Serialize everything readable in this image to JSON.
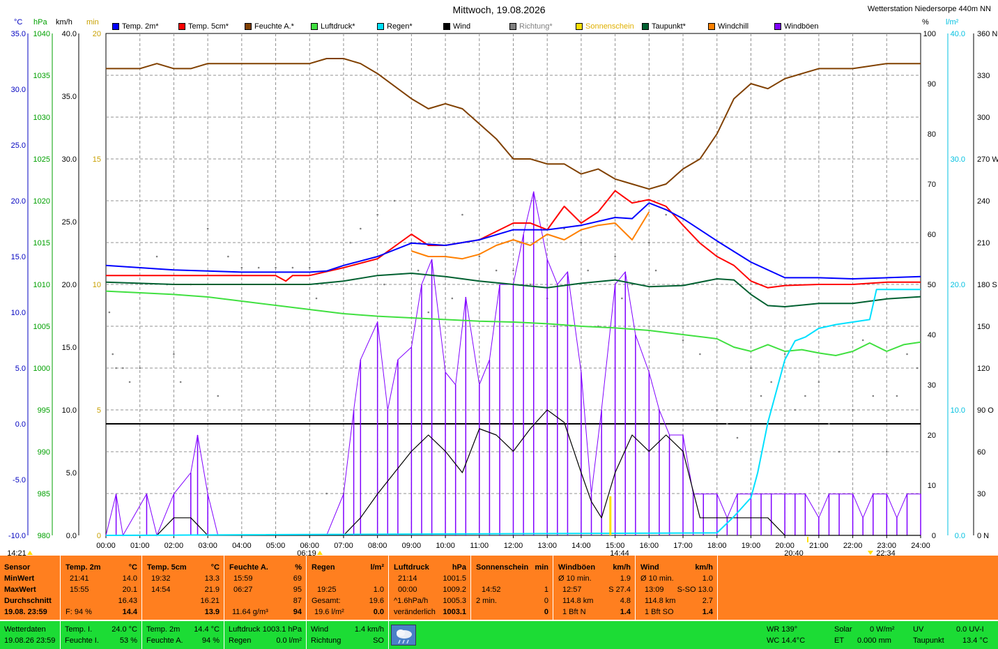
{
  "header": {
    "title": "Mittwoch, 19.08.2026",
    "station": "Wetterstation Niedersorpe 440m NN",
    "units_left": [
      "°C",
      "hPa",
      "km/h",
      "min"
    ],
    "units_right": [
      "%",
      "l/m²"
    ]
  },
  "legend": [
    {
      "label": "Temp. 2m*",
      "color": "#0000ff"
    },
    {
      "label": "Temp. 5cm*",
      "color": "#ff0000"
    },
    {
      "label": "Feuchte A.*",
      "color": "#804000"
    },
    {
      "label": "Luftdruck*",
      "color": "#40e040"
    },
    {
      "label": "Regen*",
      "color": "#00e0ff"
    },
    {
      "label": "Wind",
      "color": "#000000"
    },
    {
      "label": "Richtung*",
      "color": "#808080"
    },
    {
      "label": "Sonnenschein",
      "color": "#ffe000"
    },
    {
      "label": "Taupunkt*",
      "color": "#006030"
    },
    {
      "label": "Windchill",
      "color": "#ff8000"
    },
    {
      "label": "Windböen",
      "color": "#8000ff"
    }
  ],
  "chart_data": {
    "type": "line",
    "x_ticks": [
      "00:00",
      "01:00",
      "02:00",
      "03:00",
      "04:00",
      "05:00",
      "06:00",
      "07:00",
      "08:00",
      "09:00",
      "10:00",
      "11:00",
      "12:00",
      "13:00",
      "14:00",
      "15:00",
      "16:00",
      "17:00",
      "18:00",
      "19:00",
      "20:00",
      "21:00",
      "22:00",
      "23:00",
      "24:00"
    ],
    "axes": {
      "temp_c": {
        "ticks": [
          "35.0",
          "30.0",
          "25.0",
          "20.0",
          "15.0",
          "10.0",
          "5.0",
          "0.0",
          "-5.0",
          "-10.0"
        ],
        "range": [
          -10,
          35
        ],
        "color": "#0000c0"
      },
      "pressure_hpa": {
        "ticks": [
          "1040",
          "1035",
          "1030",
          "1025",
          "1020",
          "1015",
          "1010",
          "1005",
          "1000",
          "995",
          "990",
          "985",
          "980"
        ],
        "range": [
          980,
          1040
        ],
        "color": "#00a000"
      },
      "wind_kmh": {
        "ticks": [
          "40.0",
          "35.0",
          "30.0",
          "25.0",
          "20.0",
          "15.0",
          "10.0",
          "5.0",
          "0.0"
        ],
        "range": [
          0,
          40
        ],
        "color": "#000000"
      },
      "sun_min": {
        "ticks": [
          "20",
          "15",
          "10",
          "5",
          "0"
        ],
        "range": [
          0,
          20
        ],
        "color": "#c8a000"
      },
      "humidity_pct": {
        "ticks": [
          "100",
          "90",
          "80",
          "70",
          "60",
          "50",
          "40",
          "30",
          "20",
          "10",
          "0"
        ],
        "range": [
          0,
          100
        ],
        "color": "#000000"
      },
      "rain_lm2": {
        "ticks": [
          "40.0",
          "30.0",
          "20.0",
          "10.0",
          "0.0"
        ],
        "range": [
          0,
          40
        ],
        "color": "#00c0e0"
      },
      "direction": {
        "ticks": [
          "360 N",
          "330",
          "300",
          "270 W",
          "240",
          "210",
          "180 S",
          "150",
          "120",
          "90 O",
          "60",
          "30",
          "0 N"
        ],
        "range": [
          0,
          360
        ],
        "color": "#000000"
      }
    },
    "series": [
      {
        "name": "Temp. 2m*",
        "color": "#0000ff",
        "axis": "temp_c",
        "x": [
          0,
          1,
          2,
          3,
          4,
          5,
          6,
          6.5,
          7,
          8,
          9,
          10,
          11,
          12,
          13,
          14,
          15,
          15.5,
          16,
          16.5,
          17,
          18,
          19,
          20,
          21,
          22,
          23,
          24
        ],
        "y": [
          14.2,
          14.0,
          13.8,
          13.7,
          13.6,
          13.6,
          13.6,
          13.7,
          14.2,
          15.0,
          16.2,
          16.0,
          16.5,
          17.4,
          17.4,
          17.8,
          18.5,
          18.4,
          19.8,
          19.2,
          18.4,
          16.4,
          14.5,
          13.1,
          13.1,
          13.0,
          13.1,
          13.2
        ]
      },
      {
        "name": "Temp. 5cm*",
        "color": "#ff0000",
        "axis": "temp_c",
        "x": [
          0,
          1,
          2,
          3,
          4,
          5,
          5.3,
          5.5,
          6,
          7,
          8,
          9,
          9.5,
          10,
          11,
          12,
          12.5,
          13,
          13.5,
          14,
          14.5,
          15,
          15.5,
          16,
          16.5,
          17,
          17.5,
          18,
          18.5,
          19,
          19.5,
          20,
          21,
          22,
          23,
          24
        ],
        "y": [
          13.3,
          13.3,
          13.3,
          13.3,
          13.3,
          13.3,
          12.8,
          13.3,
          13.3,
          14.0,
          14.8,
          17.0,
          16.0,
          16.0,
          16.5,
          18.0,
          18.0,
          17.4,
          19.5,
          18.0,
          19.0,
          20.9,
          19.8,
          20.1,
          19.5,
          17.8,
          16.2,
          15.0,
          14.2,
          12.8,
          12.2,
          12.4,
          12.5,
          12.5,
          12.7,
          12.7
        ]
      },
      {
        "name": "Feuchte A.*",
        "color": "#804000",
        "axis": "humidity_pct",
        "x": [
          0,
          0.5,
          1,
          1.5,
          2,
          2.5,
          3,
          4,
          5,
          6,
          6.5,
          7,
          7.5,
          8,
          9,
          9.5,
          10,
          10.5,
          11,
          11.5,
          12,
          12.5,
          13,
          13.5,
          14,
          14.5,
          15,
          15.5,
          16,
          16.5,
          17,
          17.5,
          18,
          18.5,
          19,
          19.5,
          20,
          21,
          22,
          23,
          24
        ],
        "y": [
          93,
          93,
          93,
          94,
          93,
          93,
          94,
          94,
          94,
          94,
          95,
          95,
          94,
          92,
          87,
          85,
          86,
          85,
          82,
          79,
          75,
          75,
          74,
          74,
          72,
          73,
          71,
          70,
          69,
          70,
          73,
          75,
          80,
          87,
          90,
          89,
          91,
          93,
          93,
          94,
          94
        ]
      },
      {
        "name": "Luftdruck*",
        "color": "#40e040",
        "axis": "pressure_hpa",
        "x": [
          0,
          1,
          2,
          3,
          4,
          5,
          6,
          7,
          8,
          9,
          10,
          11,
          12,
          13,
          14,
          15,
          16,
          17,
          18,
          18.5,
          19,
          19.5,
          20,
          20.5,
          21,
          21.5,
          22,
          22.5,
          23,
          23.5,
          24
        ],
        "y": [
          1009.2,
          1009.0,
          1008.8,
          1008.5,
          1008.0,
          1007.5,
          1007.0,
          1006.5,
          1006.2,
          1006.0,
          1005.8,
          1005.6,
          1005.5,
          1005.3,
          1005.0,
          1004.8,
          1004.5,
          1004.0,
          1003.5,
          1002.5,
          1002.0,
          1002.8,
          1002.0,
          1002.2,
          1001.8,
          1001.5,
          1002.0,
          1003.0,
          1002.0,
          1002.8,
          1003.1
        ]
      },
      {
        "name": "Regen*",
        "color": "#00e0ff",
        "axis": "rain_lm2",
        "x": [
          0,
          18,
          18.5,
          19,
          19.2,
          19.5,
          20,
          20.3,
          20.6,
          21,
          21.5,
          22,
          22.5,
          22.7,
          23,
          24
        ],
        "y": [
          0,
          0.2,
          1.5,
          3.0,
          5.0,
          9.0,
          14.0,
          15.5,
          15.8,
          16.5,
          16.8,
          17.0,
          17.2,
          19.6,
          19.6,
          19.6
        ]
      },
      {
        "name": "Taupunkt*",
        "color": "#006030",
        "axis": "temp_c",
        "x": [
          0,
          1,
          2,
          3,
          4,
          5,
          6,
          7,
          8,
          9,
          10,
          11,
          12,
          13,
          14,
          15,
          16,
          17,
          18,
          18.5,
          19,
          19.5,
          20,
          21,
          22,
          23,
          24
        ],
        "y": [
          12.7,
          12.6,
          12.5,
          12.5,
          12.5,
          12.5,
          12.5,
          12.8,
          13.3,
          13.5,
          13.2,
          12.8,
          12.5,
          12.2,
          12.6,
          12.9,
          12.3,
          12.4,
          13.0,
          12.9,
          11.6,
          10.6,
          10.5,
          10.8,
          10.8,
          11.2,
          11.4
        ]
      },
      {
        "name": "Windchill",
        "color": "#ff8000",
        "axis": "temp_c",
        "x": [
          9,
          9.5,
          10,
          10.5,
          11,
          11.5,
          12,
          12.5,
          13,
          13.5,
          14,
          14.5,
          15,
          15.5,
          16
        ],
        "y": [
          15.5,
          15.0,
          15.0,
          14.8,
          15.2,
          16.0,
          16.5,
          16.0,
          17.0,
          16.5,
          17.4,
          17.8,
          18.0,
          16.5,
          19.0
        ]
      },
      {
        "name": "Wind",
        "color": "#000000",
        "axis": "wind_kmh",
        "x": [
          0,
          1.5,
          2,
          2.5,
          3,
          6,
          7,
          7.5,
          8,
          8.5,
          9,
          9.5,
          10,
          10.5,
          11,
          11.5,
          12,
          12.5,
          13,
          13.5,
          14,
          14.3,
          14.6,
          15,
          15.5,
          16,
          16.5,
          17,
          17.5,
          18,
          19,
          19.5,
          20,
          21,
          22,
          23,
          24
        ],
        "y": [
          0,
          0,
          1.4,
          1.4,
          0,
          0,
          0,
          1.4,
          3.3,
          5.0,
          6.7,
          8.0,
          6.7,
          5.0,
          8.5,
          8.0,
          6.7,
          8.5,
          10.0,
          9.0,
          5.0,
          2.7,
          1.4,
          5.0,
          8.0,
          6.7,
          8.0,
          6.7,
          1.4,
          1.4,
          1.4,
          1.4,
          0,
          0,
          0,
          0,
          0
        ]
      },
      {
        "name": "Windböen",
        "color": "#8000ff",
        "axis": "wind_kmh",
        "x": [
          0,
          0.3,
          0.5,
          1.2,
          1.5,
          2,
          2.5,
          2.7,
          3,
          3.3,
          6.5,
          7,
          7.3,
          7.5,
          8,
          8.3,
          8.6,
          9,
          9.3,
          9.6,
          10,
          10.3,
          10.6,
          11,
          11.3,
          11.6,
          12,
          12.3,
          12.6,
          13,
          13.3,
          13.6,
          14,
          14.3,
          14.6,
          15,
          15.3,
          15.6,
          16,
          16.3,
          16.6,
          17,
          17.3,
          17.6,
          18,
          18.3,
          18.6,
          19,
          19.3,
          19.6,
          20,
          20.3,
          20.6,
          21,
          21.3,
          21.6,
          22,
          22.3,
          22.6,
          23,
          23.3,
          23.6,
          24
        ],
        "y": [
          0,
          3.3,
          0,
          3.3,
          0,
          3.3,
          5.0,
          8.0,
          3.3,
          0,
          0,
          3.3,
          10.0,
          14.0,
          17.0,
          10.0,
          14.0,
          15.0,
          20.0,
          22.0,
          13.0,
          12.0,
          19.0,
          12.0,
          14.0,
          20.0,
          20.0,
          24.0,
          27.4,
          22.0,
          20.0,
          21.0,
          13.0,
          3.3,
          10.0,
          20.0,
          21.0,
          16.0,
          13.0,
          10.0,
          8.0,
          8.0,
          3.3,
          3.3,
          3.3,
          1.4,
          3.3,
          3.3,
          3.3,
          3.3,
          3.3,
          3.3,
          3.3,
          1.4,
          3.3,
          3.3,
          3.3,
          1.4,
          3.3,
          3.3,
          1.4,
          3.3,
          3.3
        ]
      },
      {
        "name": "Sonnenschein",
        "color": "#ffe000",
        "axis": "sun_min",
        "x": [
          14.86
        ],
        "y": [
          1
        ]
      }
    ],
    "direction_points": {
      "color": "#808080",
      "axis": "direction",
      "x": [
        0.1,
        0.2,
        0.3,
        0.5,
        0.7,
        1.0,
        1.5,
        1.8,
        2.0,
        2.2,
        2.5,
        3.0,
        3.3,
        3.6,
        4.0,
        4.5,
        5.0,
        5.5,
        6.0,
        6.2,
        6.5,
        7.0,
        7.2,
        7.5,
        8.0,
        8.2,
        8.5,
        9.0,
        9.2,
        9.5,
        10.0,
        10.2,
        10.5,
        11.0,
        11.5,
        12.0,
        12.2,
        12.5,
        13.0,
        13.2,
        13.5,
        14.0,
        14.2,
        14.5,
        15.0,
        15.2,
        15.5,
        16.0,
        16.2,
        16.5,
        17.0,
        17.5,
        18.0,
        18.3,
        18.6,
        19.0,
        19.3,
        19.6,
        20.0,
        20.3,
        20.6,
        21.0,
        21.3,
        21.6,
        22.0,
        22.3,
        22.6,
        23.0,
        23.3,
        23.6,
        23.9
      ],
      "y": [
        160,
        130,
        120,
        120,
        110,
        120,
        200,
        180,
        130,
        110,
        180,
        220,
        100,
        200,
        192,
        192,
        192,
        192,
        192,
        170,
        30,
        30,
        210,
        220,
        230,
        180,
        240,
        210,
        190,
        160,
        200,
        170,
        230,
        200,
        190,
        190,
        210,
        180,
        170,
        150,
        220,
        210,
        190,
        150,
        200,
        170,
        180,
        210,
        190,
        230,
        140,
        130,
        90,
        80,
        70,
        120,
        100,
        110,
        130,
        90,
        100,
        110,
        80,
        60,
        90,
        140,
        100,
        60,
        100,
        130,
        120
      ]
    }
  },
  "annotations": {
    "sunrise": "06:19",
    "sunset": "20:40",
    "moonrise": "14:21",
    "moonset": "22:34",
    "sun_peak": "14:44"
  },
  "stats": {
    "sensor": {
      "hdr": "Sensor",
      "rows": [
        "MinWert",
        "MaxWert",
        "Durchschnitt",
        "19.08. 23:59"
      ]
    },
    "temp2m": {
      "hdr": "Temp. 2m",
      "unit": "°C",
      "min_time": "21:41",
      "min": "14.0",
      "max_time": "15:55",
      "max": "20.1",
      "avg": "16.43",
      "extra": "F: 94 %",
      "cur": "14.4"
    },
    "temp5cm": {
      "hdr": "Temp. 5cm",
      "unit": "°C",
      "min_time": "19:32",
      "min": "13.3",
      "max_time": "14:54",
      "max": "21.9",
      "avg": "16.21",
      "cur": "13.9"
    },
    "feuchte": {
      "hdr": "Feuchte A.",
      "unit": "%",
      "min_time": "15:59",
      "min": "69",
      "max_time": "06:27",
      "max": "95",
      "avg": "87",
      "extra": "11.64 g/m³",
      "cur": "94"
    },
    "regen": {
      "hdr": "Regen",
      "unit": "l/m²",
      "r2_time": "19:25",
      "r2": "1.0",
      "r3_label": "Gesamt:",
      "r3": "19.6",
      "extra": "19.6 l/m²",
      "cur": "0.0"
    },
    "luftdruck": {
      "hdr": "Luftdruck",
      "unit": "hPa",
      "min_time": "21:14",
      "min": "1001.5",
      "max_time": "00:00",
      "max": "1009.2",
      "trend_label": "^1.6hPa/h",
      "avg": "1005.3",
      "extra": "veränderlich",
      "cur": "1003.1"
    },
    "sonne": {
      "hdr": "Sonnenschein",
      "unit": "min",
      "r2_time": "14:52",
      "r2": "1",
      "r3_label": "2 min.",
      "r3": "0",
      "cur": "0"
    },
    "windboen": {
      "hdr": "Windböen",
      "unit": "km/h",
      "r1_label": "Ø 10 min.",
      "r1": "1.9",
      "r2_time": "12:57",
      "r2": "S 27.4",
      "r3_label": "114.8 km",
      "r3": "4.8",
      "extra": "1 Bft N",
      "cur": "1.4"
    },
    "wind": {
      "hdr": "Wind",
      "unit": "km/h",
      "r1_label": "Ø 10 min.",
      "r1": "1.0",
      "r2_time": "13:09",
      "r2": "S-SO 13.0",
      "r3_label": "114.8 km",
      "r3": "2.7",
      "extra": "1 Bft SO",
      "cur": "1.4"
    }
  },
  "current": {
    "wetterdaten": "Wetterdaten",
    "datetime": "19.08.26 23:59",
    "temp_i_label": "Temp. I.",
    "temp_i": "24.0 °C",
    "feuchte_i_label": "Feuchte I.",
    "feuchte_i": "53 %",
    "temp2m_label": "Temp. 2m",
    "temp2m": "14.4 °C",
    "feuchte_a_label": "Feuchte A.",
    "feuchte_a": "94 %",
    "luftdruck_label": "Luftdruck",
    "luftdruck": "1003.1 hPa",
    "regen_label": "Regen",
    "regen": "0.0 l/m²",
    "wind_label": "Wind",
    "wind": "1.4 km/h",
    "richtung_label": "Richtung",
    "richtung": "SO",
    "wr": "WR 139°",
    "wc": "WC 14.4°C",
    "solar_label": "Solar",
    "solar": "0 W/m²",
    "et_label": "ET",
    "et": "0.000 mm",
    "uv_label": "UV",
    "uv": "0.0 UV-I",
    "taupunkt_label": "Taupunkt",
    "taupunkt": "13.4 °C"
  }
}
